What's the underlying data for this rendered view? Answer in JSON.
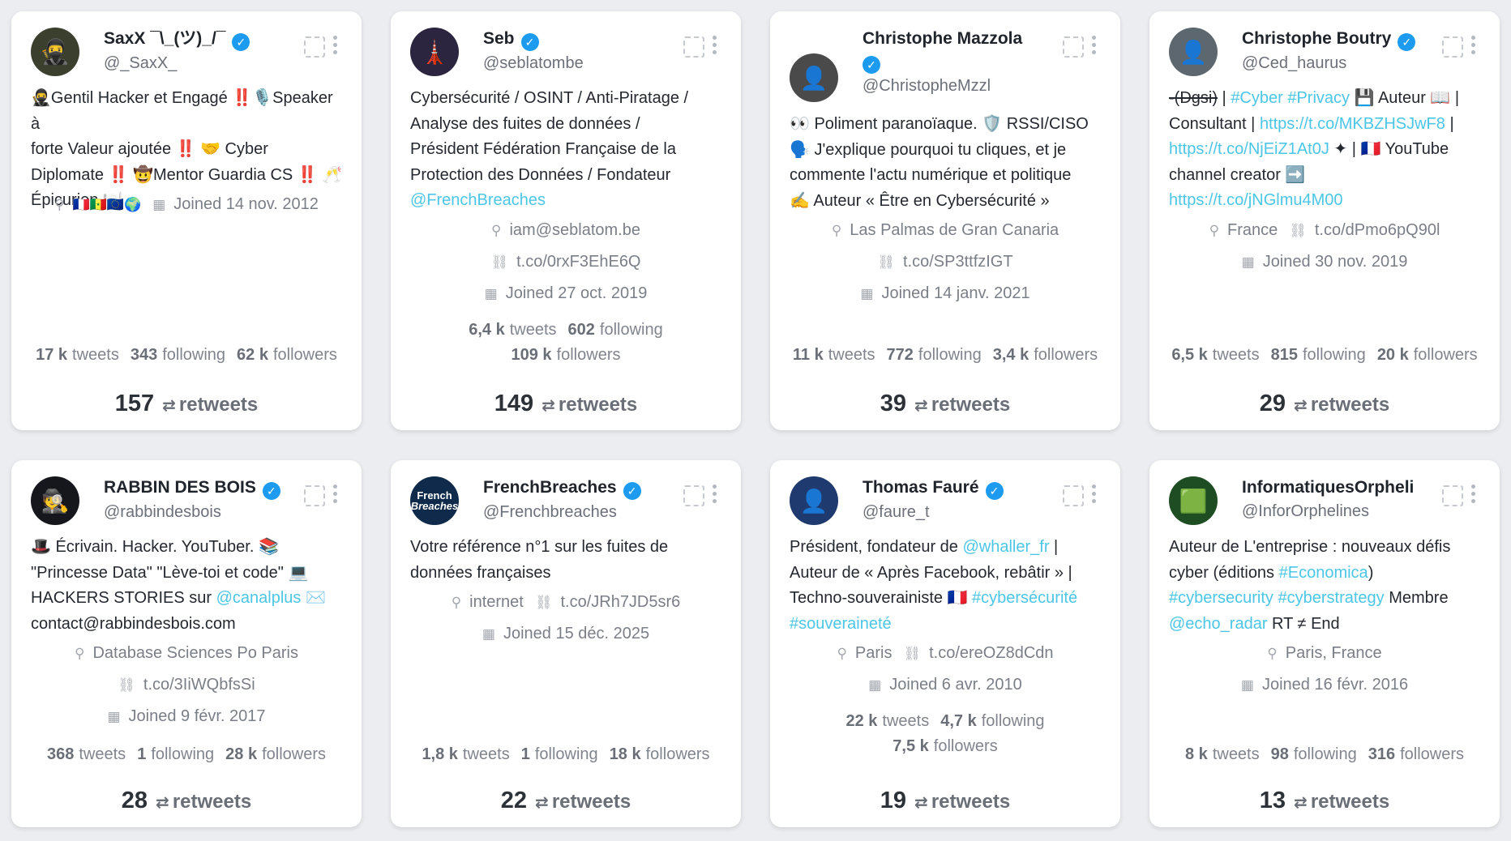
{
  "labels": {
    "tweets": "tweets",
    "following": "following",
    "followers": "followers",
    "retweets": "retweets"
  },
  "cards": [
    {
      "name": "SaxX ¯\\_(ツ)_/¯",
      "handle": "@_SaxX_",
      "avatar_color": "#3a3f2e",
      "bio_lines": [
        "🥷Gentil Hacker et Engagé ‼️🎙️Speaker à",
        "forte Valeur ajoutée ‼️ 🤝 Cyber",
        "Diplomate ‼️ 🤠Mentor Guardia CS ‼️ 🥂",
        "Épicurien 🍽️"
      ],
      "location": "🇫🇷🇸🇳🇪🇺🌍",
      "joined": "Joined 14 nov. 2012",
      "tweets": "17 k",
      "following": "343",
      "followers": "62 k",
      "retweets": "157"
    },
    {
      "name": "Seb",
      "handle": "@seblatombe",
      "avatar_color": "#2b2540",
      "bio_lines": [
        "Cybersécurité / OSINT / Anti-Piratage /",
        "Analyse des fuites de données /",
        "Président Fédération Française de la",
        "Protection des Données / Fondateur"
      ],
      "bio_link": "@FrenchBreaches",
      "location": "iam@seblatom.be",
      "url": "t.co/0rxF3EhE6Q",
      "joined": "Joined 27 oct. 2019",
      "tweets": "6,4 k",
      "following": "602",
      "followers": "109 k",
      "retweets": "149"
    },
    {
      "name": "Christophe Mazzola",
      "handle": "@ChristopheMzzl",
      "avatar_color": "#4b4a4a",
      "bio_lines": [
        "👀 Poliment paranoïaque. 🛡️ RSSI/CISO",
        "🗣️ J'explique pourquoi tu cliques, et je",
        "commente l'actu numérique et politique",
        "✍️ Auteur « Être en Cybersécurité »"
      ],
      "location": "Las Palmas de Gran Canaria",
      "url": "t.co/SP3ttfzIGT",
      "joined": "Joined 14 janv. 2021",
      "tweets": "11 k",
      "following": "772",
      "followers": "3,4 k",
      "retweets": "39"
    },
    {
      "name": "Christophe Boutry",
      "handle": "@Ced_haurus",
      "avatar_color": "#5d6770",
      "bio_1a": "-(Dgsi)",
      "bio_1b": " | ",
      "bio_1c": "#Cyber #Privacy",
      "bio_1d": " 💾 Auteur 📖 |",
      "bio_2a": "Consultant | ",
      "bio_2b": "https://t.co/MKBZHSJwF8",
      "bio_2c": " |",
      "bio_3a": "https://t.co/NjEiZ1At0J",
      "bio_3b": " ✦ | 🇫🇷 YouTube",
      "bio_4": "channel creator ➡️",
      "bio_5": "https://t.co/jNGlmu4M00",
      "location": "France",
      "url": "t.co/dPmo6pQ90l",
      "joined": "Joined 30 nov. 2019",
      "tweets": "6,5 k",
      "following": "815",
      "followers": "20 k",
      "retweets": "29"
    },
    {
      "name": "RABBIN DES BOIS",
      "handle": "@rabbindesbois",
      "avatar_color": "#15171c",
      "bio_lines": [
        "🎩 Écrivain. Hacker. YouTuber. 📚",
        "\"Princesse Data\" \"Lève-toi et code\" 💻"
      ],
      "bio_3a": "HACKERS STORIES sur ",
      "bio_3b": "@canalplus",
      "bio_3c": " ✉️",
      "bio_4": "contact@rabbindesbois.com",
      "location": "Database Sciences Po Paris",
      "url": "t.co/3IiWQbfsSi",
      "joined": "Joined 9 févr. 2017",
      "tweets": "368",
      "following": "1",
      "followers": "28 k",
      "retweets": "28"
    },
    {
      "name": "FrenchBreaches",
      "handle": "@Frenchbreaches",
      "avatar_color": "#0f2a4a",
      "avatar_text_1": "French",
      "avatar_text_2": "Breaches",
      "bio_lines": [
        "Votre référence n°1 sur les fuites de",
        "données françaises"
      ],
      "location": "internet",
      "url": "t.co/JRh7JD5sr6",
      "joined": "Joined 15 déc. 2025",
      "tweets": "1,8 k",
      "following": "1",
      "followers": "18 k",
      "retweets": "22"
    },
    {
      "name": "Thomas Fauré",
      "handle": "@faure_t",
      "avatar_color": "#1f3a6e",
      "bio_1a": "Président, fondateur de ",
      "bio_1b": "@whaller_fr",
      "bio_1c": " |",
      "bio_2": "Auteur de « Après Facebook, rebâtir » |",
      "bio_3a": "Techno-souverainiste 🇫🇷 ",
      "bio_3b": "#cybersécurité",
      "bio_4": "#souveraineté",
      "location": "Paris",
      "url": "t.co/ereOZ8dCdn",
      "joined": "Joined 6 avr. 2010",
      "tweets": "22 k",
      "following": "4,7 k",
      "followers": "7,5 k",
      "retweets": "19"
    },
    {
      "name": "InformatiquesOrpheli",
      "handle": "@InforOrphelines",
      "avatar_color": "#1e4d24",
      "bio_1": "Auteur de L'entreprise : nouveaux défis",
      "bio_2a": "cyber (éditions ",
      "bio_2b": "#Economica",
      "bio_2c": ")",
      "bio_3a": "#cybersecurity #cyberstrategy",
      "bio_3b": " Membre",
      "bio_4a": "@echo_radar",
      "bio_4b": " RT ≠ End",
      "location": "Paris, France",
      "joined": "Joined 16 févr. 2016",
      "tweets": "8 k",
      "following": "98",
      "followers": "316",
      "retweets": "13"
    }
  ]
}
